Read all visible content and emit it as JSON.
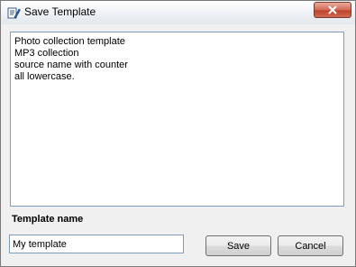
{
  "window": {
    "title": "Save Template",
    "close_icon": "close-icon",
    "app_icon": "template-edit-icon"
  },
  "templates_list": {
    "lines": [
      "Photo collection template",
      "MP3 collection",
      "source name with counter",
      "all lowercase."
    ]
  },
  "form": {
    "template_name_label": "Template name",
    "template_name_value": "My template"
  },
  "buttons": {
    "save_label": "Save",
    "cancel_label": "Cancel"
  },
  "colors": {
    "close_button": "#c94f38",
    "field_border": "#7f9db9"
  }
}
